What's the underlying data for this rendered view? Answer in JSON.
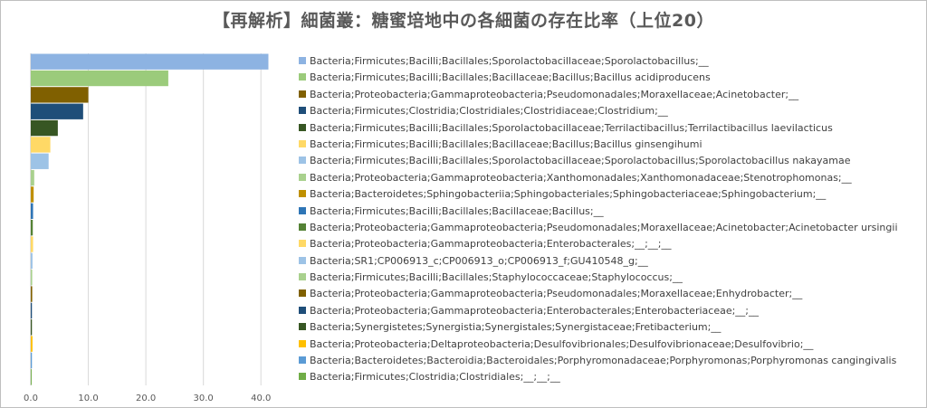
{
  "chart_data": {
    "type": "bar",
    "orientation": "horizontal",
    "title": "【再解析】細菌叢：糖蜜培地中の各細菌の存在比率（上位20）",
    "xlim": [
      0,
      45
    ],
    "xticks": [
      "0.0",
      "10.0",
      "20.0",
      "30.0",
      "40.0"
    ],
    "xtick_values": [
      0,
      10,
      20,
      30,
      40
    ],
    "grid": true,
    "legend_position": "right",
    "series": [
      {
        "name": "Bacteria;Firmicutes;Bacilli;Bacillales;Sporolactobacillaceae;Sporolactobacillus;__",
        "value": 41.3,
        "color": "#8db3e2"
      },
      {
        "name": "Bacteria;Firmicutes;Bacilli;Bacillales;Bacillaceae;Bacillus;Bacillus acidiproducens",
        "value": 23.9,
        "color": "#9bcb7b"
      },
      {
        "name": "Bacteria;Proteobacteria;Gammaproteobacteria;Pseudomonadales;Moraxellaceae;Acinetobacter;__",
        "value": 10.0,
        "color": "#806000"
      },
      {
        "name": "Bacteria;Firmicutes;Clostridia;Clostridiales;Clostridiaceae;Clostridium;__",
        "value": 9.1,
        "color": "#1f4e79"
      },
      {
        "name": "Bacteria;Firmicutes;Bacilli;Bacillales;Sporolactobacillaceae;Terrilactibacillus;Terrilactibacillus laevilacticus",
        "value": 4.7,
        "color": "#375623"
      },
      {
        "name": "Bacteria;Firmicutes;Bacilli;Bacillales;Bacillaceae;Bacillus;Bacillus ginsengihumi",
        "value": 3.4,
        "color": "#ffd966"
      },
      {
        "name": "Bacteria;Firmicutes;Bacilli;Bacillales;Sporolactobacillaceae;Sporolactobacillus;Sporolactobacillus nakayamae",
        "value": 3.1,
        "color": "#9dc3e6"
      },
      {
        "name": "Bacteria;Proteobacteria;Gammaproteobacteria;Xanthomonadales;Xanthomonadaceae;Stenotrophomonas;__",
        "value": 0.6,
        "color": "#a9d18e"
      },
      {
        "name": "Bacteria;Bacteroidetes;Sphingobacteriia;Sphingobacteriales;Sphingobacteriaceae;Sphingobacterium;__",
        "value": 0.5,
        "color": "#bf9000"
      },
      {
        "name": "Bacteria;Firmicutes;Bacilli;Bacillales;Bacillaceae;Bacillus;__",
        "value": 0.4,
        "color": "#2e75b6"
      },
      {
        "name": "Bacteria;Proteobacteria;Gammaproteobacteria;Pseudomonadales;Moraxellaceae;Acinetobacter;Acinetobacter ursingii",
        "value": 0.35,
        "color": "#548235"
      },
      {
        "name": "Bacteria;Proteobacteria;Gammaproteobacteria;Enterobacterales;__;__;__",
        "value": 0.4,
        "color": "#ffd966"
      },
      {
        "name": "Bacteria;SR1;CP006913_c;CP006913_o;CP006913_f;GU410548_g;__",
        "value": 0.3,
        "color": "#9dc3e6"
      },
      {
        "name": "Bacteria;Firmicutes;Bacilli;Bacillales;Staphylococcaceae;Staphylococcus;__",
        "value": 0.25,
        "color": "#a9d18e"
      },
      {
        "name": "Bacteria;Proteobacteria;Gammaproteobacteria;Pseudomonadales;Moraxellaceae;Enhydrobacter;__",
        "value": 0.25,
        "color": "#806000"
      },
      {
        "name": "Bacteria;Proteobacteria;Gammaproteobacteria;Enterobacterales;Enterobacteriaceae;__;__",
        "value": 0.2,
        "color": "#1f4e79"
      },
      {
        "name": "Bacteria;Synergistetes;Synergistia;Synergistales;Synergistaceae;Fretibacterium;__",
        "value": 0.2,
        "color": "#375623"
      },
      {
        "name": "Bacteria;Proteobacteria;Deltaproteobacteria;Desulfovibrionales;Desulfovibrionaceae;Desulfovibrio;__",
        "value": 0.3,
        "color": "#ffc000"
      },
      {
        "name": "Bacteria;Bacteroidetes;Bacteroidia;Bacteroidales;Porphyromonadaceae;Porphyromonas;Porphyromonas cangingivalis",
        "value": 0.2,
        "color": "#5b9bd5"
      },
      {
        "name": "Bacteria;Firmicutes;Clostridia;Clostridiales;__;__;__",
        "value": 0.15,
        "color": "#70ad47"
      }
    ]
  }
}
